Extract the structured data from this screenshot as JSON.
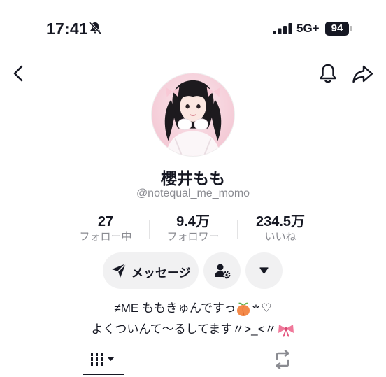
{
  "status_bar": {
    "time": "17:41",
    "network": "5G+",
    "battery": "94"
  },
  "profile": {
    "nickname": "櫻井もも",
    "handle": "@notequal_me_momo"
  },
  "stats": [
    {
      "value": "27",
      "label": "フォロー中"
    },
    {
      "value": "9.4万",
      "label": "フォロワー"
    },
    {
      "value": "234.5万",
      "label": "いいね"
    }
  ],
  "actions": {
    "message_label": "メッセージ"
  },
  "bio": {
    "line1": "≠ME ももきゅんですっ",
    "line1_suffix": "♡",
    "line2": "よくついんて〜るしてます〃>_<〃"
  },
  "icons": {
    "back": "chevron-left-icon",
    "bell": "bell-icon",
    "share": "share-icon",
    "muted": "bell-slash-icon",
    "send": "paper-plane-icon",
    "follow_settings": "user-gear-icon",
    "more": "caret-down-icon",
    "grid_tab": "video-grid-icon",
    "repost_tab": "repost-icon",
    "peach": "peach-emoji",
    "ribbon": "ribbon-emoji"
  },
  "colors": {
    "text": "#161823",
    "muted_text": "#8a8b91",
    "button_bg": "#f1f1f2",
    "ribbon": "#f0789a",
    "peach": "#f48a4a"
  }
}
